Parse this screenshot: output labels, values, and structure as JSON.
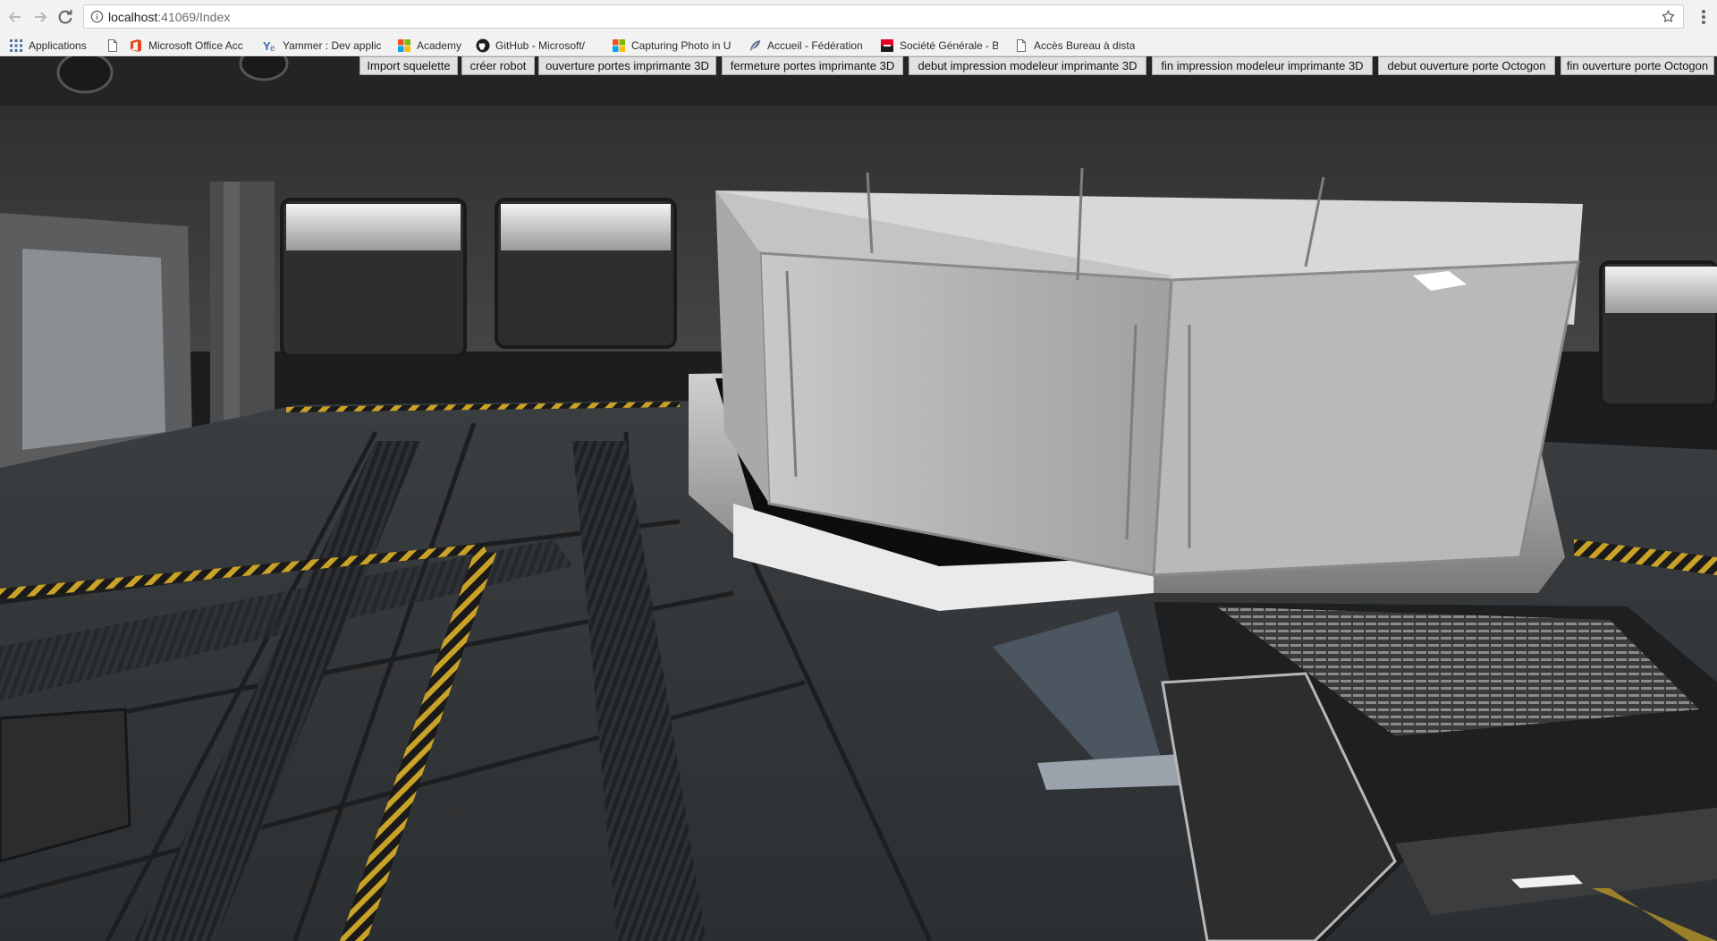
{
  "browser": {
    "url_host": "localhost",
    "url_rest": ":41069/Index",
    "bookmarks": [
      {
        "label": "Applications",
        "icon": "apps-grid-icon"
      },
      {
        "label": "",
        "icon": "page-icon"
      },
      {
        "label": "Microsoft Office Acc",
        "icon": "office-icon"
      },
      {
        "label": "Yammer : Dev applic",
        "icon": "yammer-icon"
      },
      {
        "label": "Academy",
        "icon": "microsoft-icon"
      },
      {
        "label": "GitHub - Microsoft/",
        "icon": "github-icon"
      },
      {
        "label": "Capturing Photo in U",
        "icon": "microsoft-icon"
      },
      {
        "label": "Accueil - Fédération",
        "icon": "feather-icon"
      },
      {
        "label": "Société Générale - B",
        "icon": "societe-generale-icon"
      },
      {
        "label": "Accès Bureau à dista",
        "icon": "page-icon"
      }
    ]
  },
  "toolbar": {
    "buttons": [
      "Import squelette",
      "créer robot",
      "ouverture portes imprimante 3D",
      "fermeture portes imprimante 3D",
      "debut impression modeleur imprimante 3D",
      "fin impression modeleur imprimante 3D",
      "debut ouverture porte Octogon",
      "fin ouverture porte Octogon"
    ]
  },
  "colors": {
    "chrome_bg": "#f2f2f2",
    "button_bg": "#e1e1e1",
    "scene_floor": "#3a3d3f",
    "hazard_yellow": "#c9a227"
  }
}
